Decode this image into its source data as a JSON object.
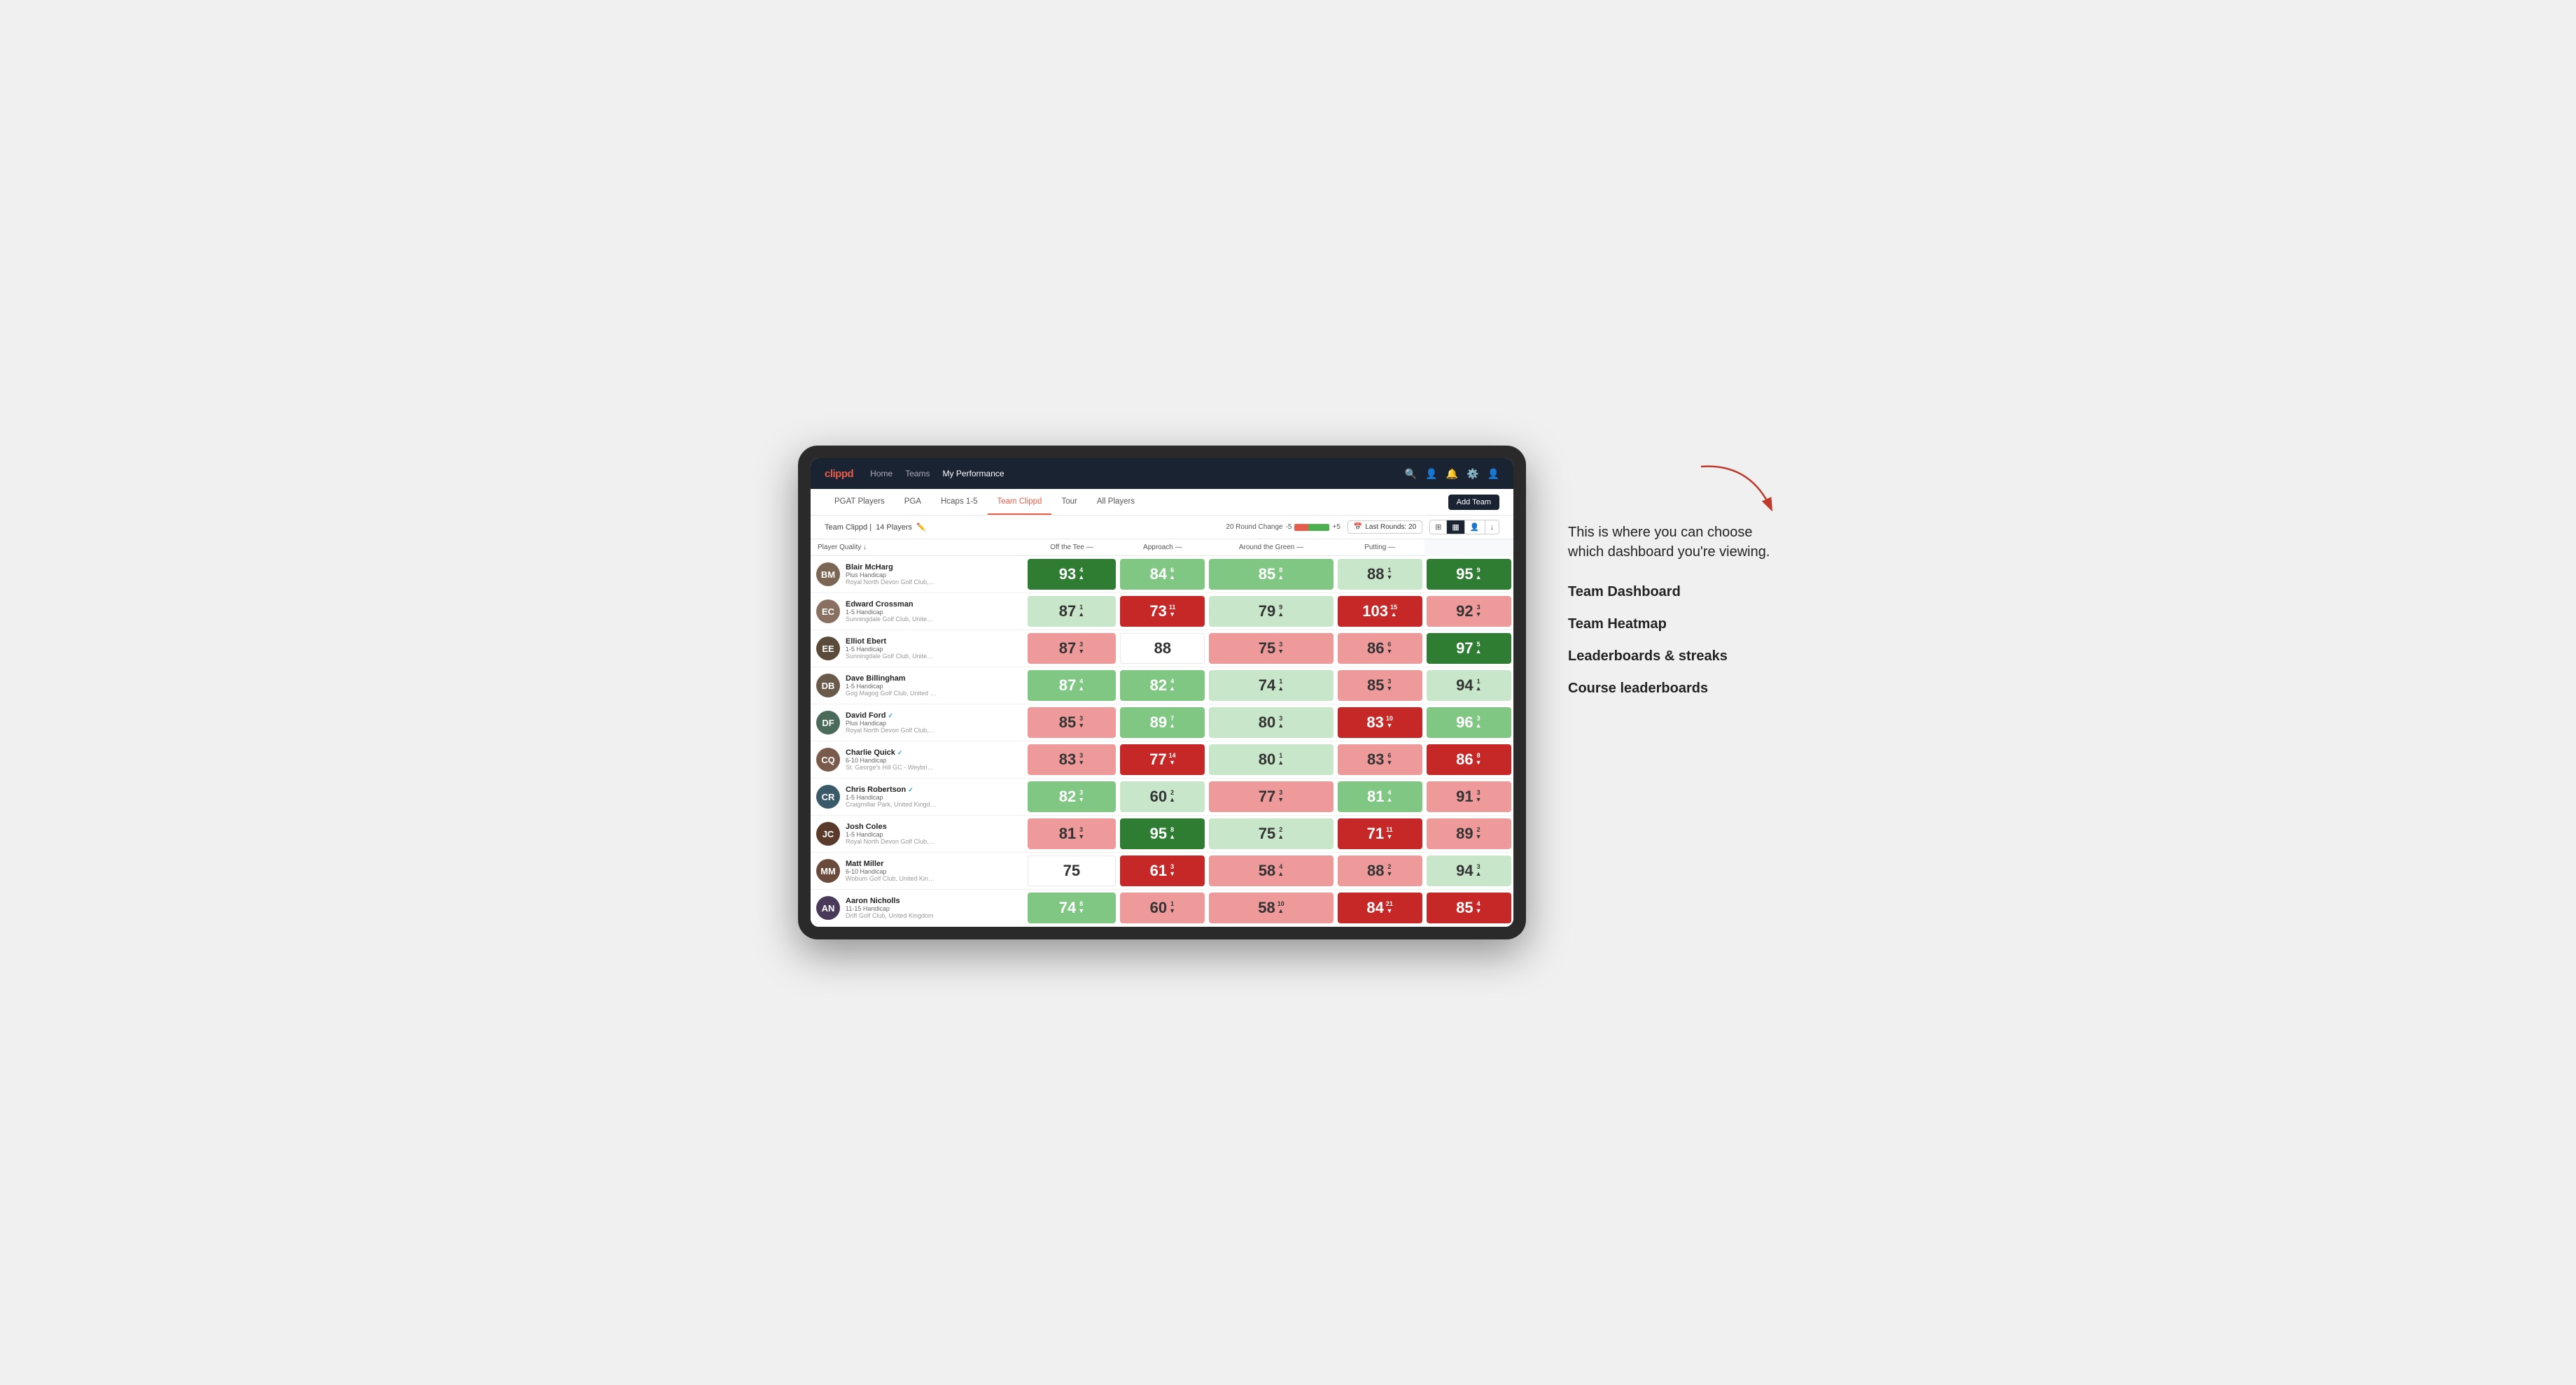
{
  "annotation": {
    "intro": "This is where you can choose which dashboard you're viewing.",
    "items": [
      "Team Dashboard",
      "Team Heatmap",
      "Leaderboards & streaks",
      "Course leaderboards"
    ]
  },
  "nav": {
    "logo": "clippd",
    "links": [
      "Home",
      "Teams",
      "My Performance"
    ],
    "active_link": "My Performance"
  },
  "tabs": {
    "items": [
      "PGAT Players",
      "PGA",
      "Hcaps 1-5",
      "Team Clippd",
      "Tour",
      "All Players"
    ],
    "active": "Team Clippd",
    "add_team_label": "Add Team"
  },
  "team_header": {
    "team_name": "Team Clippd",
    "player_count": "14 Players",
    "round_change_label": "20 Round Change",
    "neg_label": "-5",
    "pos_label": "+5",
    "last_rounds_label": "Last Rounds: 20"
  },
  "columns": {
    "player": "Player Quality ↓",
    "off_tee": "Off the Tee —",
    "approach": "Approach —",
    "around_green": "Around the Green —",
    "putting": "Putting —"
  },
  "players": [
    {
      "name": "Blair McHarg",
      "handicap": "Plus Handicap",
      "club": "Royal North Devon Golf Club, United Kingdom",
      "avatar_color": "#7a6652",
      "initials": "BM",
      "scores": {
        "quality": {
          "value": 93,
          "change": "+4",
          "dir": "up",
          "bg": "bg-green-strong"
        },
        "off_tee": {
          "value": 84,
          "change": "+6",
          "dir": "up",
          "bg": "bg-green-light"
        },
        "approach": {
          "value": 85,
          "change": "+8",
          "dir": "up",
          "bg": "bg-green-light"
        },
        "around_green": {
          "value": 88,
          "change": "-1",
          "dir": "down",
          "bg": "bg-green-pale"
        },
        "putting": {
          "value": 95,
          "change": "+9",
          "dir": "up",
          "bg": "bg-green-strong"
        }
      }
    },
    {
      "name": "Edward Crossman",
      "handicap": "1-5 Handicap",
      "club": "Sunningdale Golf Club, United Kingdom",
      "avatar_color": "#8a7060",
      "initials": "EC",
      "verified": false,
      "scores": {
        "quality": {
          "value": 87,
          "change": "+1",
          "dir": "up",
          "bg": "bg-green-pale"
        },
        "off_tee": {
          "value": 73,
          "change": "-11",
          "dir": "down",
          "bg": "bg-red-strong"
        },
        "approach": {
          "value": 79,
          "change": "+9",
          "dir": "up",
          "bg": "bg-green-pale"
        },
        "around_green": {
          "value": 103,
          "change": "+15",
          "dir": "up",
          "bg": "bg-red-strong"
        },
        "putting": {
          "value": 92,
          "change": "-3",
          "dir": "down",
          "bg": "bg-red-light"
        }
      }
    },
    {
      "name": "Elliot Ebert",
      "handicap": "1-5 Handicap",
      "club": "Sunningdale Golf Club, United Kingdom",
      "avatar_color": "#5a4a3a",
      "initials": "EE",
      "scores": {
        "quality": {
          "value": 87,
          "change": "-3",
          "dir": "down",
          "bg": "bg-red-light"
        },
        "off_tee": {
          "value": 88,
          "change": "",
          "dir": "",
          "bg": "bg-white"
        },
        "approach": {
          "value": 75,
          "change": "-3",
          "dir": "down",
          "bg": "bg-red-light"
        },
        "around_green": {
          "value": 86,
          "change": "-6",
          "dir": "down",
          "bg": "bg-red-light"
        },
        "putting": {
          "value": 97,
          "change": "+5",
          "dir": "up",
          "bg": "bg-green-strong"
        }
      }
    },
    {
      "name": "Dave Billingham",
      "handicap": "1-5 Handicap",
      "club": "Gog Magog Golf Club, United Kingdom",
      "avatar_color": "#6a5a4a",
      "initials": "DB",
      "scores": {
        "quality": {
          "value": 87,
          "change": "+4",
          "dir": "up",
          "bg": "bg-green-light"
        },
        "off_tee": {
          "value": 82,
          "change": "+4",
          "dir": "up",
          "bg": "bg-green-light"
        },
        "approach": {
          "value": 74,
          "change": "+1",
          "dir": "up",
          "bg": "bg-green-pale"
        },
        "around_green": {
          "value": 85,
          "change": "-3",
          "dir": "down",
          "bg": "bg-red-light"
        },
        "putting": {
          "value": 94,
          "change": "+1",
          "dir": "up",
          "bg": "bg-green-pale"
        }
      }
    },
    {
      "name": "David Ford",
      "handicap": "Plus Handicap",
      "club": "Royal North Devon Golf Club, United Kingdom",
      "avatar_color": "#4a6a5a",
      "initials": "DF",
      "verified": true,
      "scores": {
        "quality": {
          "value": 85,
          "change": "-3",
          "dir": "down",
          "bg": "bg-red-light"
        },
        "off_tee": {
          "value": 89,
          "change": "+7",
          "dir": "up",
          "bg": "bg-green-light"
        },
        "approach": {
          "value": 80,
          "change": "+3",
          "dir": "up",
          "bg": "bg-green-pale"
        },
        "around_green": {
          "value": 83,
          "change": "-10",
          "dir": "down",
          "bg": "bg-red-strong"
        },
        "putting": {
          "value": 96,
          "change": "+3",
          "dir": "up",
          "bg": "bg-green-light"
        }
      }
    },
    {
      "name": "Charlie Quick",
      "handicap": "6-10 Handicap",
      "club": "St. George's Hill GC - Weybridge - Surrey, Uni...",
      "avatar_color": "#7a5a4a",
      "initials": "CQ",
      "verified": true,
      "scores": {
        "quality": {
          "value": 83,
          "change": "-3",
          "dir": "down",
          "bg": "bg-red-light"
        },
        "off_tee": {
          "value": 77,
          "change": "-14",
          "dir": "down",
          "bg": "bg-red-strong"
        },
        "approach": {
          "value": 80,
          "change": "+1",
          "dir": "up",
          "bg": "bg-green-pale"
        },
        "around_green": {
          "value": 83,
          "change": "-6",
          "dir": "down",
          "bg": "bg-red-light"
        },
        "putting": {
          "value": 86,
          "change": "-8",
          "dir": "down",
          "bg": "bg-red-strong"
        }
      }
    },
    {
      "name": "Chris Robertson",
      "handicap": "1-5 Handicap",
      "club": "Craigmillar Park, United Kingdom",
      "avatar_color": "#3a5a6a",
      "initials": "CR",
      "verified": true,
      "scores": {
        "quality": {
          "value": 82,
          "change": "-3",
          "dir": "down",
          "bg": "bg-green-light"
        },
        "off_tee": {
          "value": 60,
          "change": "+2",
          "dir": "up",
          "bg": "bg-green-pale"
        },
        "approach": {
          "value": 77,
          "change": "-3",
          "dir": "down",
          "bg": "bg-red-light"
        },
        "around_green": {
          "value": 81,
          "change": "+4",
          "dir": "up",
          "bg": "bg-green-light"
        },
        "putting": {
          "value": 91,
          "change": "-3",
          "dir": "down",
          "bg": "bg-red-light"
        }
      }
    },
    {
      "name": "Josh Coles",
      "handicap": "1-5 Handicap",
      "club": "Royal North Devon Golf Club, United Kingdom",
      "avatar_color": "#5a3a2a",
      "initials": "JC",
      "scores": {
        "quality": {
          "value": 81,
          "change": "-3",
          "dir": "down",
          "bg": "bg-red-light"
        },
        "off_tee": {
          "value": 95,
          "change": "+8",
          "dir": "up",
          "bg": "bg-green-strong"
        },
        "approach": {
          "value": 75,
          "change": "+2",
          "dir": "up",
          "bg": "bg-green-pale"
        },
        "around_green": {
          "value": 71,
          "change": "-11",
          "dir": "down",
          "bg": "bg-red-strong"
        },
        "putting": {
          "value": 89,
          "change": "-2",
          "dir": "down",
          "bg": "bg-red-light"
        }
      }
    },
    {
      "name": "Matt Miller",
      "handicap": "6-10 Handicap",
      "club": "Woburn Golf Club, United Kingdom",
      "avatar_color": "#6a4a3a",
      "initials": "MM",
      "scores": {
        "quality": {
          "value": 75,
          "change": "",
          "dir": "",
          "bg": "bg-white"
        },
        "off_tee": {
          "value": 61,
          "change": "-3",
          "dir": "down",
          "bg": "bg-red-strong"
        },
        "approach": {
          "value": 58,
          "change": "+4",
          "dir": "up",
          "bg": "bg-red-light"
        },
        "around_green": {
          "value": 88,
          "change": "-2",
          "dir": "down",
          "bg": "bg-red-light"
        },
        "putting": {
          "value": 94,
          "change": "+3",
          "dir": "up",
          "bg": "bg-green-pale"
        }
      }
    },
    {
      "name": "Aaron Nicholls",
      "handicap": "11-15 Handicap",
      "club": "Drift Golf Club, United Kingdom",
      "avatar_color": "#4a3a5a",
      "initials": "AN",
      "scores": {
        "quality": {
          "value": 74,
          "change": "-8",
          "dir": "down",
          "bg": "bg-green-light"
        },
        "off_tee": {
          "value": 60,
          "change": "-1",
          "dir": "down",
          "bg": "bg-red-light"
        },
        "approach": {
          "value": 58,
          "change": "+10",
          "dir": "up",
          "bg": "bg-red-light"
        },
        "around_green": {
          "value": 84,
          "change": "-21",
          "dir": "down",
          "bg": "bg-red-strong"
        },
        "putting": {
          "value": 85,
          "change": "-4",
          "dir": "down",
          "bg": "bg-red-strong"
        }
      }
    }
  ]
}
